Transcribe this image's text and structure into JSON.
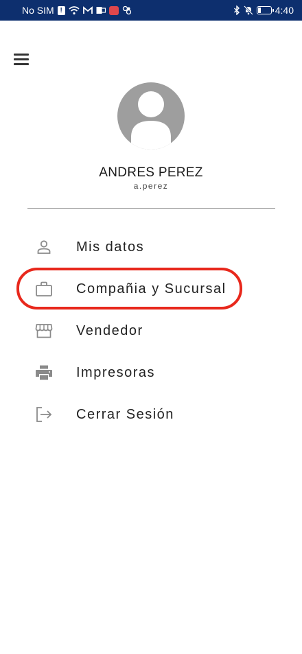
{
  "status_bar": {
    "carrier": "No SIM",
    "time": "4:40"
  },
  "profile": {
    "name": "ANDRES PEREZ",
    "username": "a.perez"
  },
  "menu": {
    "items": [
      {
        "label": "Mis datos",
        "icon": "person-icon"
      },
      {
        "label": "Compañia y Sucursal",
        "icon": "briefcase-icon"
      },
      {
        "label": "Vendedor",
        "icon": "store-icon"
      },
      {
        "label": "Impresoras",
        "icon": "printer-icon"
      },
      {
        "label": "Cerrar Sesión",
        "icon": "logout-icon"
      }
    ]
  },
  "colors": {
    "status_bar": "#0d2f6e",
    "highlight": "#e8281c",
    "avatar": "#9e9e9e",
    "icon": "#8a8a8a"
  }
}
